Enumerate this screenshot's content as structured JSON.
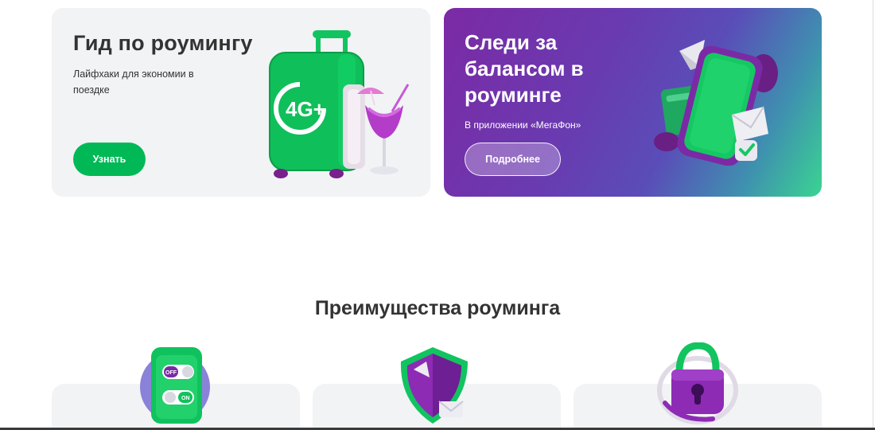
{
  "promo_cards": {
    "guide": {
      "title": "Гид по роумингу",
      "subtitle": "Лайфхаки для экономии в поездке",
      "button_label": "Узнать",
      "illustration_icon": "suitcase-4g-icon"
    },
    "balance": {
      "title": "Следи за балансом в роуминге",
      "subtitle": "В приложении «МегаФон»",
      "button_label": "Подробнее",
      "illustration_icon": "phone-app-icon"
    }
  },
  "benefits": {
    "title": "Преимущества роуминга",
    "cards": [
      {
        "icon": "toggle-switches-icon",
        "toggle_off_label": "OFF",
        "toggle_on_label": "ON"
      },
      {
        "icon": "shield-icon"
      },
      {
        "icon": "padlock-icon"
      }
    ]
  },
  "colors": {
    "brand_green": "#00b956",
    "brand_purple": "#731982",
    "card_background": "#f2f3f5",
    "text_primary": "#333333"
  }
}
